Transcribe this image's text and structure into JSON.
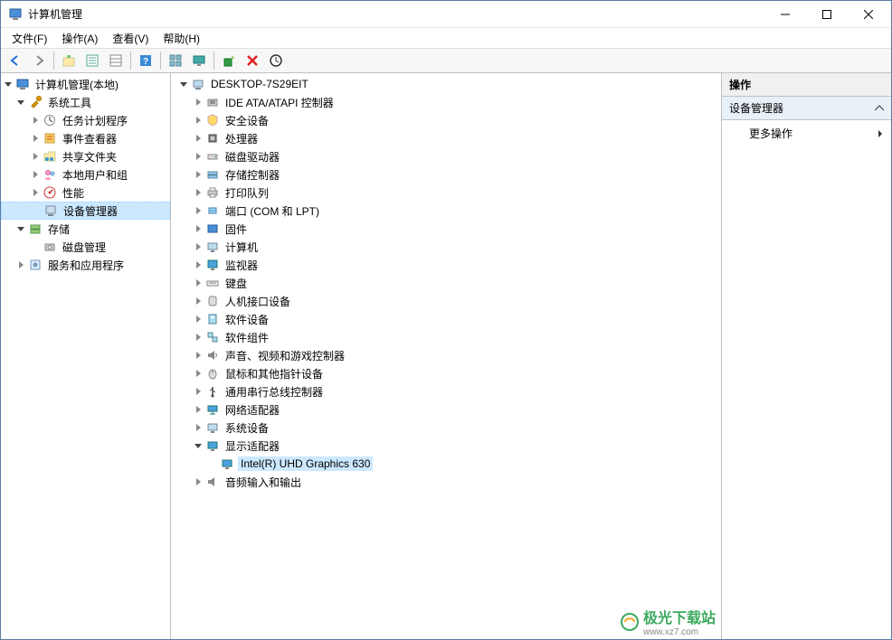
{
  "window": {
    "title": "计算机管理"
  },
  "menu": {
    "file": "文件(F)",
    "action": "操作(A)",
    "view": "查看(V)",
    "help": "帮助(H)"
  },
  "left_tree": {
    "root": "计算机管理(本地)",
    "system_tools": "系统工具",
    "task_scheduler": "任务计划程序",
    "event_viewer": "事件查看器",
    "shared_folders": "共享文件夹",
    "local_users": "本地用户和组",
    "performance": "性能",
    "device_manager": "设备管理器",
    "storage": "存储",
    "disk_management": "磁盘管理",
    "services_apps": "服务和应用程序"
  },
  "center_tree": {
    "root": "DESKTOP-7S29EIT",
    "ide": "IDE ATA/ATAPI 控制器",
    "security": "安全设备",
    "processor": "处理器",
    "disk_drives": "磁盘驱动器",
    "storage_ctrl": "存储控制器",
    "print_queue": "打印队列",
    "ports": "端口 (COM 和 LPT)",
    "firmware": "固件",
    "computer": "计算机",
    "monitor": "监视器",
    "keyboard": "键盘",
    "hid": "人机接口设备",
    "software_dev": "软件设备",
    "software_comp": "软件组件",
    "sound": "声音、视频和游戏控制器",
    "mouse": "鼠标和其他指针设备",
    "usb": "通用串行总线控制器",
    "network": "网络适配器",
    "system_dev": "系统设备",
    "display": "显示适配器",
    "display_item": "Intel(R) UHD Graphics 630",
    "audio_io": "音频输入和输出"
  },
  "actions": {
    "header": "操作",
    "section": "设备管理器",
    "more": "更多操作"
  },
  "watermark": {
    "brand": "极光下载站",
    "url": "www.xz7.com"
  }
}
